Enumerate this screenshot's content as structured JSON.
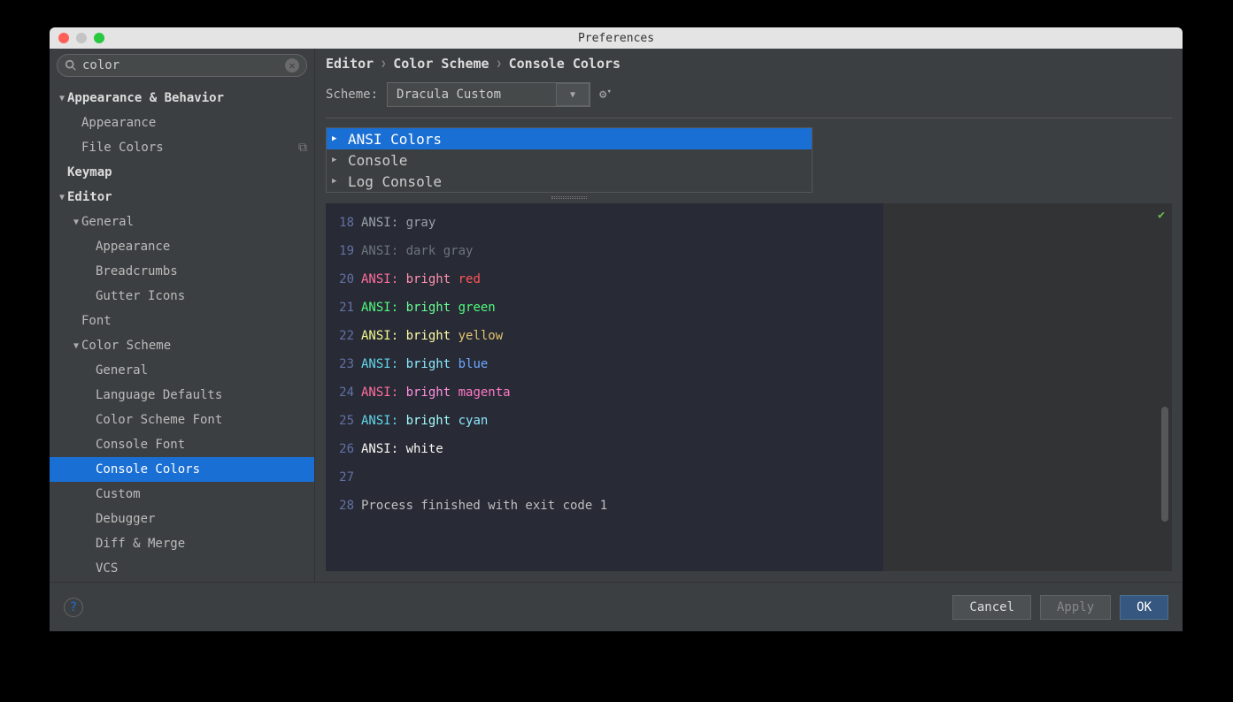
{
  "window": {
    "title": "Preferences"
  },
  "search": {
    "value": "color",
    "placeholder": ""
  },
  "sidebar": {
    "items": [
      {
        "label": "Appearance & Behavior",
        "indent": 0,
        "expanded": true,
        "bold": true
      },
      {
        "label": "Appearance",
        "indent": 1
      },
      {
        "label": "File Colors",
        "indent": 1,
        "badge": "⧉"
      },
      {
        "label": "Keymap",
        "indent": 0,
        "bold": true
      },
      {
        "label": "Editor",
        "indent": 0,
        "expanded": true,
        "bold": true
      },
      {
        "label": "General",
        "indent": 1,
        "expanded": true
      },
      {
        "label": "Appearance",
        "indent": 2
      },
      {
        "label": "Breadcrumbs",
        "indent": 2
      },
      {
        "label": "Gutter Icons",
        "indent": 2
      },
      {
        "label": "Font",
        "indent": 1
      },
      {
        "label": "Color Scheme",
        "indent": 1,
        "expanded": true
      },
      {
        "label": "General",
        "indent": 2
      },
      {
        "label": "Language Defaults",
        "indent": 2
      },
      {
        "label": "Color Scheme Font",
        "indent": 2
      },
      {
        "label": "Console Font",
        "indent": 2
      },
      {
        "label": "Console Colors",
        "indent": 2,
        "selected": true
      },
      {
        "label": "Custom",
        "indent": 2
      },
      {
        "label": "Debugger",
        "indent": 2
      },
      {
        "label": "Diff & Merge",
        "indent": 2
      },
      {
        "label": "VCS",
        "indent": 2
      }
    ]
  },
  "breadcrumb": [
    "Editor",
    "Color Scheme",
    "Console Colors"
  ],
  "scheme": {
    "label": "Scheme:",
    "value": "Dracula Custom"
  },
  "categories": [
    {
      "label": "ANSI Colors",
      "selected": true
    },
    {
      "label": "Console"
    },
    {
      "label": "Log Console"
    }
  ],
  "preview": {
    "lines": [
      {
        "n": 18,
        "segments": [
          {
            "t": "ANSI: gray",
            "c": "#9aa2a8"
          }
        ]
      },
      {
        "n": 19,
        "segments": [
          {
            "t": "ANSI: dark gray",
            "c": "#6c757d"
          }
        ]
      },
      {
        "n": 20,
        "segments": [
          {
            "t": "ANSI: ",
            "c": "#ff6e9c"
          },
          {
            "t": "bright ",
            "c": "#ff92b0"
          },
          {
            "t": "red",
            "c": "#ff5555"
          }
        ]
      },
      {
        "n": 21,
        "segments": [
          {
            "t": "ANSI: ",
            "c": "#50fa7b"
          },
          {
            "t": "bright ",
            "c": "#69ff94"
          },
          {
            "t": "green",
            "c": "#50fa7b"
          }
        ]
      },
      {
        "n": 22,
        "segments": [
          {
            "t": "ANSI: ",
            "c": "#f1fa8c"
          },
          {
            "t": "bright ",
            "c": "#ffffa5"
          },
          {
            "t": "yellow",
            "c": "#e0c46c"
          }
        ]
      },
      {
        "n": 23,
        "segments": [
          {
            "t": "ANSI: ",
            "c": "#62d6e8"
          },
          {
            "t": "bright ",
            "c": "#8be9fd"
          },
          {
            "t": "blue",
            "c": "#6aa9ff"
          }
        ]
      },
      {
        "n": 24,
        "segments": [
          {
            "t": "ANSI: ",
            "c": "#ff6e9c"
          },
          {
            "t": "bright ",
            "c": "#ff92df"
          },
          {
            "t": "magenta",
            "c": "#ff79c6"
          }
        ]
      },
      {
        "n": 25,
        "segments": [
          {
            "t": "ANSI: ",
            "c": "#62d6e8"
          },
          {
            "t": "bright ",
            "c": "#a4ffff"
          },
          {
            "t": "cyan",
            "c": "#8be9fd"
          }
        ]
      },
      {
        "n": 26,
        "segments": [
          {
            "t": "ANSI: white",
            "c": "#f8f8f2"
          }
        ]
      },
      {
        "n": 27,
        "segments": [
          {
            "t": "",
            "c": "#f8f8f2"
          }
        ]
      },
      {
        "n": 28,
        "segments": [
          {
            "t": "Process finished with exit code 1",
            "c": "#bfbfbf"
          }
        ]
      }
    ]
  },
  "footer": {
    "cancel": "Cancel",
    "apply": "Apply",
    "ok": "OK"
  }
}
